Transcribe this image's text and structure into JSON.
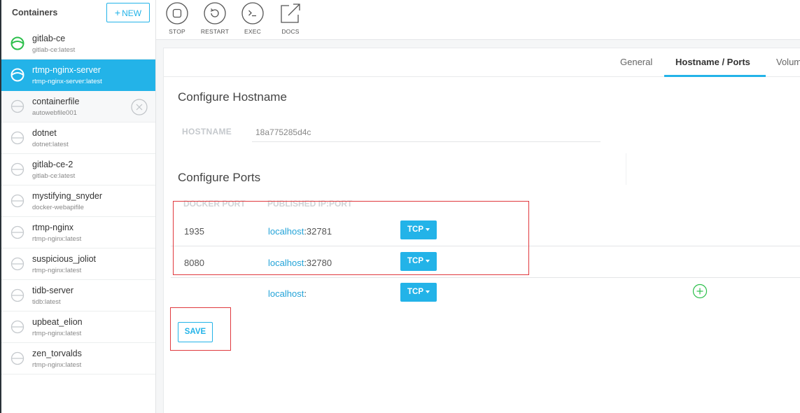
{
  "sidebar": {
    "title": "Containers",
    "new_button": {
      "plus": "+",
      "label": "NEW"
    },
    "items": [
      {
        "name": "gitlab-ce",
        "image": "gitlab-ce:latest",
        "status": "running",
        "selected": false
      },
      {
        "name": "rtmp-nginx-server",
        "image": "rtmp-nginx-server:latest",
        "status": "running",
        "selected": true
      },
      {
        "name": "containerfile",
        "image": "autowebfile001",
        "status": "stopped",
        "selected": false,
        "hover": true
      },
      {
        "name": "dotnet",
        "image": "dotnet:latest",
        "status": "stopped",
        "selected": false
      },
      {
        "name": "gitlab-ce-2",
        "image": "gitlab-ce:latest",
        "status": "stopped",
        "selected": false
      },
      {
        "name": "mystifying_snyder",
        "image": "docker-webapifile",
        "status": "stopped",
        "selected": false
      },
      {
        "name": "rtmp-nginx",
        "image": "rtmp-nginx:latest",
        "status": "stopped",
        "selected": false
      },
      {
        "name": "suspicious_joliot",
        "image": "rtmp-nginx:latest",
        "status": "stopped",
        "selected": false
      },
      {
        "name": "tidb-server",
        "image": "tidb:latest",
        "status": "stopped",
        "selected": false
      },
      {
        "name": "upbeat_elion",
        "image": "rtmp-nginx:latest",
        "status": "stopped",
        "selected": false
      },
      {
        "name": "zen_torvalds",
        "image": "rtmp-nginx:latest",
        "status": "stopped",
        "selected": false
      }
    ]
  },
  "toolbar": {
    "buttons": [
      {
        "label": "STOP",
        "icon": "stop-icon"
      },
      {
        "label": "RESTART",
        "icon": "restart-icon"
      },
      {
        "label": "EXEC",
        "icon": "terminal-icon"
      },
      {
        "label": "DOCS",
        "icon": "external-link-icon"
      }
    ]
  },
  "tabs": [
    {
      "label": "General",
      "active": false
    },
    {
      "label": "Hostname / Ports",
      "active": true
    },
    {
      "label": "Volum",
      "active": false
    }
  ],
  "hostname": {
    "section_title": "Configure Hostname",
    "label": "HOSTNAME",
    "value": "18a775285d4c"
  },
  "ports": {
    "section_title": "Configure Ports",
    "headers": {
      "docker_port": "DOCKER PORT",
      "published": "PUBLISHED IP:PORT"
    },
    "rows": [
      {
        "docker_port": "1935",
        "host": "localhost",
        "port": ":32781",
        "protocol": "TCP"
      },
      {
        "docker_port": "8080",
        "host": "localhost",
        "port": ":32780",
        "protocol": "TCP"
      },
      {
        "docker_port": "",
        "host": "localhost",
        "port": ":",
        "protocol": "TCP"
      }
    ]
  },
  "save_button": "SAVE",
  "colors": {
    "accent": "#23b3e8",
    "running": "#2bbf4a",
    "stopped": "#c5c9cd",
    "highlight": "#e0393e"
  }
}
